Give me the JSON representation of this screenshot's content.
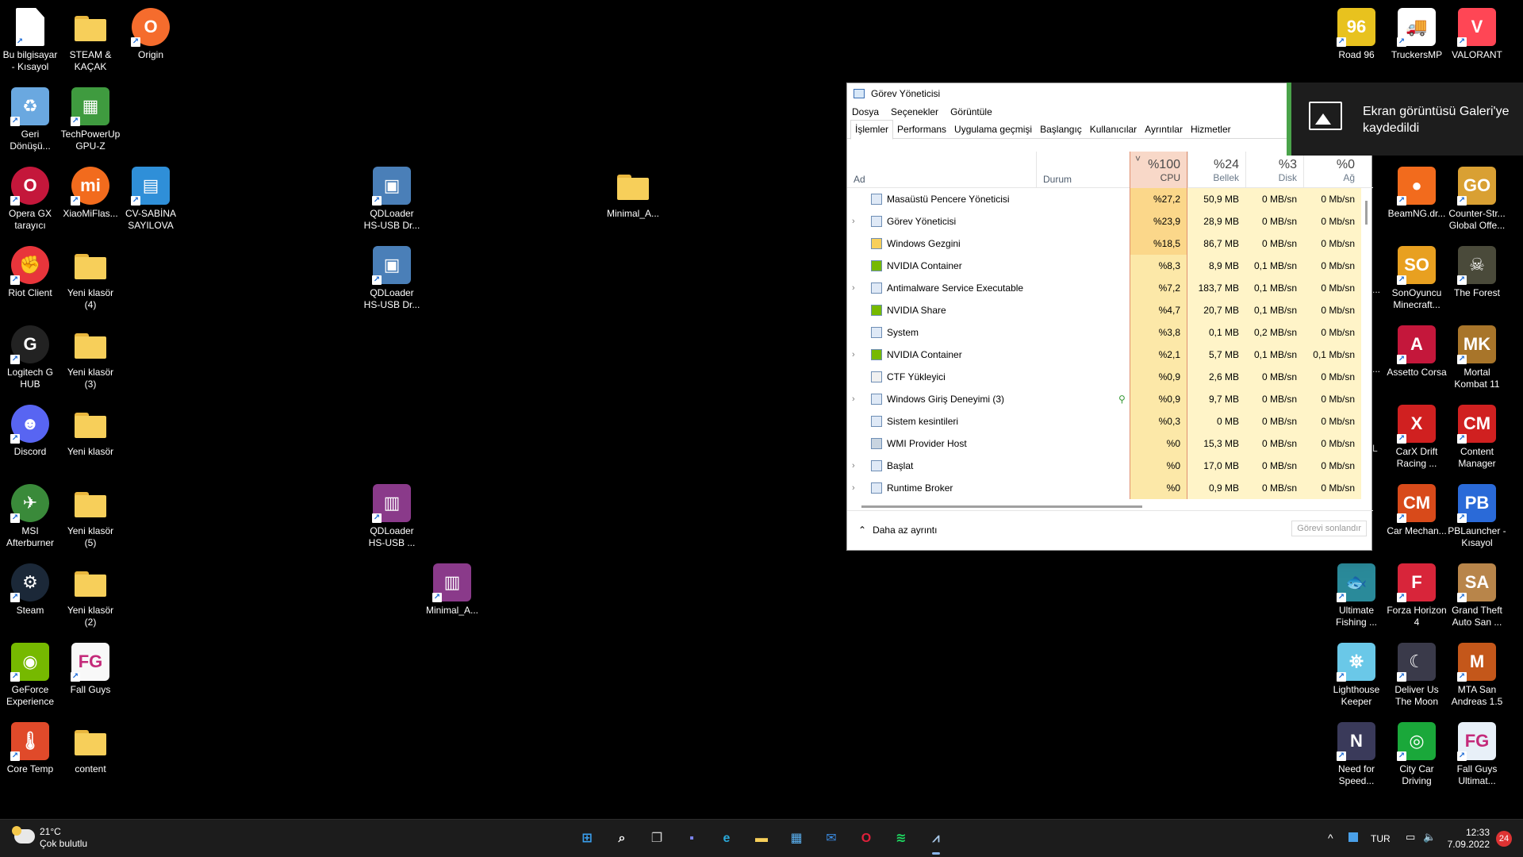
{
  "desktop": {
    "left_icons": [
      {
        "label": "Bu bilgisayar - Kısayol",
        "icon": "this-pc-icon",
        "color": "#ffffff",
        "kind": "doc"
      },
      {
        "label": "STEAM & KAÇAK",
        "icon": "folder-icon",
        "kind": "folder"
      },
      {
        "label": "Origin",
        "icon": "origin-icon",
        "color": "#f56c2d",
        "kind": "round",
        "glyph": "O"
      },
      {
        "label": "Geri Dönüşü...",
        "icon": "recycle-bin-icon",
        "color": "#6aa8e0",
        "kind": "plain",
        "glyph": "♻"
      },
      {
        "label": "TechPowerUp GPU-Z",
        "icon": "gpuz-icon",
        "color": "#3f9b3f",
        "kind": "plain",
        "glyph": "▦"
      },
      {
        "label": "Opera GX tarayıcı",
        "icon": "opera-gx-icon",
        "color": "#c4173b",
        "kind": "round",
        "glyph": "O"
      },
      {
        "label": "XiaoMiFlas...",
        "icon": "xiaomi-flash-icon",
        "color": "#f26b1d",
        "kind": "round",
        "glyph": "mi"
      },
      {
        "label": "CV-SABİNA SAYILOVA",
        "icon": "document-icon",
        "color": "#2f8fd8",
        "kind": "plain",
        "glyph": "▤"
      },
      {
        "label": "Riot Client",
        "icon": "riot-client-icon",
        "color": "#e8353b",
        "kind": "round",
        "glyph": "✊"
      },
      {
        "label": "Yeni klasör (4)",
        "icon": "folder-icon",
        "kind": "folder"
      },
      {
        "label": "Logitech G HUB",
        "icon": "logitech-ghub-icon",
        "color": "#222222",
        "kind": "round",
        "glyph": "G"
      },
      {
        "label": "Yeni klasör (3)",
        "icon": "folder-icon",
        "kind": "folder"
      },
      {
        "label": "Discord",
        "icon": "discord-icon",
        "color": "#5865f2",
        "kind": "round",
        "glyph": "☻"
      },
      {
        "label": "Yeni klasör",
        "icon": "folder-icon",
        "kind": "folder"
      },
      {
        "label": "MSI Afterburner",
        "icon": "msi-afterburner-icon",
        "color": "#3a8a3a",
        "kind": "round",
        "glyph": "✈"
      },
      {
        "label": "Yeni klasör (5)",
        "icon": "folder-icon",
        "kind": "folder"
      },
      {
        "label": "Steam",
        "icon": "steam-icon",
        "color": "#1b2838",
        "kind": "round",
        "glyph": "⚙"
      },
      {
        "label": "Yeni klasör (2)",
        "icon": "folder-icon",
        "kind": "folder"
      },
      {
        "label": "GeForce Experience",
        "icon": "geforce-icon",
        "color": "#76b900",
        "kind": "plain",
        "glyph": "◉"
      },
      {
        "label": "Fall Guys",
        "icon": "fall-guys-icon",
        "color": "#f8f8f8",
        "kind": "plain",
        "glyph": "FG"
      },
      {
        "label": "Core Temp",
        "icon": "core-temp-icon",
        "color": "#e04a2a",
        "kind": "plain",
        "glyph": "🌡"
      },
      {
        "label": "content",
        "icon": "folder-icon",
        "kind": "folder"
      },
      {
        "label": "QDLoader HS-USB Dr...",
        "icon": "installer-icon",
        "color": "#4a7fb8",
        "kind": "plain",
        "glyph": "▣"
      },
      {
        "label": "QDLoader HS-USB Dr...",
        "icon": "installer-icon",
        "color": "#4a7fb8",
        "kind": "plain",
        "glyph": "▣"
      },
      {
        "label": "QDLoader HS-USB ...",
        "icon": "winrar-icon",
        "color": "#8a3a8a",
        "kind": "plain",
        "glyph": "▥"
      },
      {
        "label": "Minimal_A...",
        "icon": "folder-icon",
        "kind": "folder"
      },
      {
        "label": "Minimal_A...",
        "icon": "winrar-icon",
        "color": "#8a3a8a",
        "kind": "plain",
        "glyph": "▥"
      }
    ],
    "right_icons": [
      {
        "label": "Road 96",
        "icon": "road96-icon",
        "color": "#e8c21e",
        "glyph": "96"
      },
      {
        "label": "TruckersMP",
        "icon": "truckersmp-icon",
        "color": "#ffffff",
        "glyph": "🚚"
      },
      {
        "label": "VALORANT",
        "icon": "valorant-icon",
        "color": "#ff4655",
        "glyph": "V"
      },
      {
        "label": "BeamNG.dr...",
        "icon": "beamng-icon",
        "color": "#f26b1d",
        "glyph": "●"
      },
      {
        "label": "Counter-Str... Global Offe...",
        "icon": "csgo-icon",
        "color": "#d9a033",
        "glyph": "GO"
      },
      {
        "label": "SonOyuncu Minecraft...",
        "icon": "sonoyuncu-icon",
        "color": "#e8a020",
        "glyph": "SO"
      },
      {
        "label": "The Forest",
        "icon": "the-forest-icon",
        "color": "#4a4a3a",
        "glyph": "☠"
      },
      {
        "label": "Assetto Corsa",
        "icon": "assetto-corsa-icon",
        "color": "#c4173b",
        "glyph": "A"
      },
      {
        "label": "Mortal Kombat 11",
        "icon": "mortal-kombat-icon",
        "color": "#a8752a",
        "glyph": "MK"
      },
      {
        "label": "CarX Drift Racing ...",
        "icon": "carx-icon",
        "color": "#d02020",
        "glyph": "X"
      },
      {
        "label": "Content Manager",
        "icon": "content-manager-icon",
        "color": "#d02020",
        "glyph": "CM"
      },
      {
        "label": "Car Mechan...",
        "icon": "car-mechanic-icon",
        "color": "#d84a1a",
        "glyph": "CM"
      },
      {
        "label": "PBLauncher - Kısayol",
        "icon": "pblauncher-icon",
        "color": "#2a6ad8",
        "glyph": "PB"
      },
      {
        "label": "Ultimate Fishing ...",
        "icon": "fishing-icon",
        "color": "#2a8a9a",
        "glyph": "🐟"
      },
      {
        "label": "Forza Horizon 4",
        "icon": "forza-icon",
        "color": "#d8253a",
        "glyph": "F"
      },
      {
        "label": "Grand Theft Auto San ...",
        "icon": "gta-sa-icon",
        "color": "#b8854a",
        "glyph": "SA"
      },
      {
        "label": "Lighthouse Keeper",
        "icon": "lighthouse-icon",
        "color": "#6ac8e8",
        "glyph": "⛯"
      },
      {
        "label": "Deliver Us The Moon",
        "icon": "deliver-moon-icon",
        "color": "#3a3a4a",
        "glyph": "☾"
      },
      {
        "label": "MTA San Andreas 1.5",
        "icon": "mta-icon",
        "color": "#c4571a",
        "glyph": "M"
      },
      {
        "label": "Need for Speed...",
        "icon": "nfs-icon",
        "color": "#3a3a5a",
        "glyph": "N"
      },
      {
        "label": "City Car Driving",
        "icon": "city-car-icon",
        "color": "#1aa83a",
        "glyph": "◎"
      },
      {
        "label": "Fall Guys Ultimat...",
        "icon": "fall-guys-icon",
        "color": "#e8f0f8",
        "glyph": "FG"
      }
    ],
    "partial_labels": [
      "...",
      "...",
      "L"
    ]
  },
  "taskmanager": {
    "title": "Görev Yöneticisi",
    "menu": [
      "Dosya",
      "Seçenekler",
      "Görüntüle"
    ],
    "tabs": [
      "İşlemler",
      "Performans",
      "Uygulama geçmişi",
      "Başlangıç",
      "Kullanıcılar",
      "Ayrıntılar",
      "Hizmetler"
    ],
    "sort_arrow": "˅",
    "headers": {
      "name": "Ad",
      "status": "Durum",
      "cpu_pct": "%100",
      "cpu": "CPU",
      "mem_pct": "%24",
      "mem": "Bellek",
      "disk_pct": "%3",
      "disk": "Disk",
      "net_pct": "%0",
      "net": "Ağ"
    },
    "processes": [
      {
        "name": "Masaüstü Pencere Yöneticisi",
        "expand": "",
        "cpu": "%27,2",
        "mem": "50,9 MB",
        "disk": "0 MB/sn",
        "net": "0 Mb/sn",
        "icon": "window-icon",
        "leaf": ""
      },
      {
        "name": "Görev Yöneticisi",
        "expand": "›",
        "cpu": "%23,9",
        "mem": "28,9 MB",
        "disk": "0 MB/sn",
        "net": "0 Mb/sn",
        "icon": "taskmgr-icon",
        "leaf": ""
      },
      {
        "name": "Windows Gezgini",
        "expand": "",
        "cpu": "%18,5",
        "mem": "86,7 MB",
        "disk": "0 MB/sn",
        "net": "0 Mb/sn",
        "icon": "explorer-icon",
        "leaf": ""
      },
      {
        "name": "NVIDIA Container",
        "expand": "",
        "cpu": "%8,3",
        "mem": "8,9 MB",
        "disk": "0,1 MB/sn",
        "net": "0 Mb/sn",
        "icon": "nvidia-icon",
        "leaf": ""
      },
      {
        "name": "Antimalware Service Executable",
        "expand": "›",
        "cpu": "%7,2",
        "mem": "183,7 MB",
        "disk": "0,1 MB/sn",
        "net": "0 Mb/sn",
        "icon": "window-icon",
        "leaf": ""
      },
      {
        "name": "NVIDIA Share",
        "expand": "",
        "cpu": "%4,7",
        "mem": "20,7 MB",
        "disk": "0,1 MB/sn",
        "net": "0 Mb/sn",
        "icon": "nvidia-icon",
        "leaf": ""
      },
      {
        "name": "System",
        "expand": "",
        "cpu": "%3,8",
        "mem": "0,1 MB",
        "disk": "0,2 MB/sn",
        "net": "0 Mb/sn",
        "icon": "window-icon",
        "leaf": ""
      },
      {
        "name": "NVIDIA Container",
        "expand": "›",
        "cpu": "%2,1",
        "mem": "5,7 MB",
        "disk": "0,1 MB/sn",
        "net": "0,1 Mb/sn",
        "icon": "nvidia-icon",
        "leaf": ""
      },
      {
        "name": "CTF Yükleyici",
        "expand": "",
        "cpu": "%0,9",
        "mem": "2,6 MB",
        "disk": "0 MB/sn",
        "net": "0 Mb/sn",
        "icon": "ctf-icon",
        "leaf": ""
      },
      {
        "name": "Windows Giriş Deneyimi (3)",
        "expand": "›",
        "cpu": "%0,9",
        "mem": "9,7 MB",
        "disk": "0 MB/sn",
        "net": "0 Mb/sn",
        "icon": "window-icon",
        "leaf": "⚲"
      },
      {
        "name": "Sistem kesintileri",
        "expand": "",
        "cpu": "%0,3",
        "mem": "0 MB",
        "disk": "0 MB/sn",
        "net": "0 Mb/sn",
        "icon": "window-icon",
        "leaf": ""
      },
      {
        "name": "WMI Provider Host",
        "expand": "",
        "cpu": "%0",
        "mem": "15,3 MB",
        "disk": "0 MB/sn",
        "net": "0 Mb/sn",
        "icon": "wmi-icon",
        "leaf": ""
      },
      {
        "name": "Başlat",
        "expand": "›",
        "cpu": "%0",
        "mem": "17,0 MB",
        "disk": "0 MB/sn",
        "net": "0 Mb/sn",
        "icon": "window-icon",
        "leaf": ""
      },
      {
        "name": "Runtime Broker",
        "expand": "›",
        "cpu": "%0",
        "mem": "0,9 MB",
        "disk": "0 MB/sn",
        "net": "0 Mb/sn",
        "icon": "window-icon",
        "leaf": ""
      }
    ],
    "footer": {
      "less": "Daha az ayrıntı",
      "less_icon": "⌃",
      "end": "Görevi sonlandır"
    }
  },
  "toast": {
    "text": "Ekran görüntüsü Galeri'ye kaydedildi"
  },
  "taskbar": {
    "weather": {
      "temp": "21°C",
      "desc": "Çok bulutlu"
    },
    "apps": [
      {
        "name": "start-button",
        "icon": "windows-logo-icon",
        "color": "#3aa0f0",
        "glyph": "⊞"
      },
      {
        "name": "search-button",
        "icon": "search-icon",
        "color": "#ffffff",
        "glyph": "⌕"
      },
      {
        "name": "task-view-button",
        "icon": "task-view-icon",
        "color": "#d0d0d0",
        "glyph": "❐"
      },
      {
        "name": "teams-chat-button",
        "icon": "chat-icon",
        "color": "#7b83eb",
        "glyph": "▪"
      },
      {
        "name": "edge-button",
        "icon": "edge-icon",
        "color": "#2aa8d8",
        "glyph": "e"
      },
      {
        "name": "file-explorer-button",
        "icon": "folder-icon",
        "color": "#f7cf5a",
        "glyph": "▬"
      },
      {
        "name": "store-button",
        "icon": "store-icon",
        "color": "#5ab0f0",
        "glyph": "▦"
      },
      {
        "name": "mail-button",
        "icon": "mail-icon",
        "color": "#3a8ae0",
        "glyph": "✉"
      },
      {
        "name": "opera-button",
        "icon": "opera-icon",
        "color": "#e0203a",
        "glyph": "O"
      },
      {
        "name": "spotify-button",
        "icon": "spotify-icon",
        "color": "#1ed760",
        "glyph": "≋"
      },
      {
        "name": "task-manager-button",
        "icon": "taskmgr-icon",
        "color": "#a8c8e8",
        "glyph": "⩘"
      }
    ],
    "tray": {
      "chevron": "^",
      "lang": "TUR",
      "time": "12:33",
      "date": "7.09.2022",
      "notifications": "24"
    }
  }
}
